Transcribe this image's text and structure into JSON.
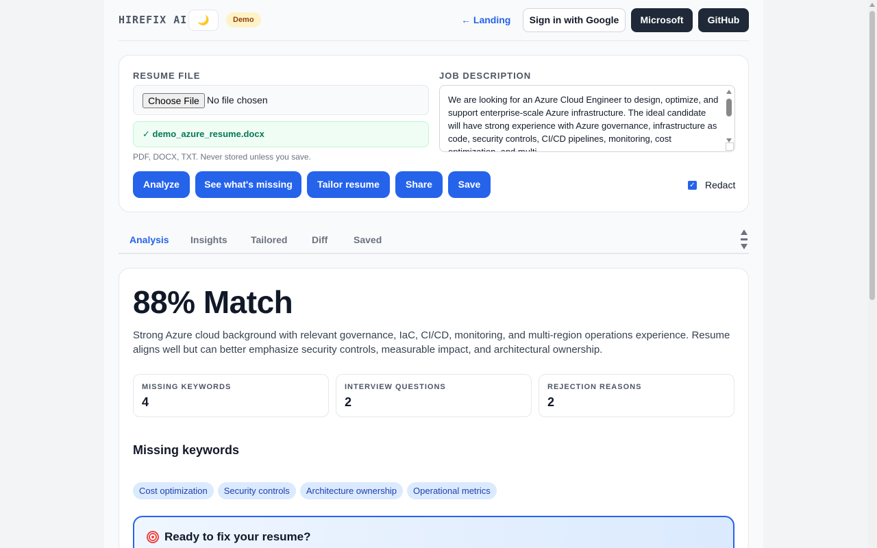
{
  "header": {
    "brand": "HIREFIX AI",
    "theme_icon": "moon-icon",
    "demo_badge": "Demo",
    "landing_link": "← Landing",
    "sign_in_google": "Sign in with Google",
    "microsoft": "Microsoft",
    "github": "GitHub"
  },
  "upload": {
    "resume_label": "RESUME FILE",
    "choose_file": "Choose File",
    "no_file": "No file chosen",
    "uploaded_file": "✓ demo_azure_resume.docx",
    "file_hint": "PDF, DOCX, TXT. Never stored unless you save.",
    "jd_label": "JOB DESCRIPTION",
    "jd_text": "We are looking for an Azure Cloud Engineer to design, optimize, and support enterprise-scale Azure infrastructure. The ideal candidate will have strong experience with Azure governance, infrastructure as code, security controls, CI/CD pipelines, monitoring, cost optimization, and multi-"
  },
  "actions": {
    "analyze": "Analyze",
    "see_missing": "See what's missing",
    "tailor": "Tailor resume",
    "share": "Share",
    "save": "Save",
    "redact_label": "Redact",
    "redact_checked": true
  },
  "tabs": [
    {
      "label": "Analysis",
      "active": true
    },
    {
      "label": "Insights",
      "active": false
    },
    {
      "label": "Tailored",
      "active": false
    },
    {
      "label": "Diff",
      "active": false
    },
    {
      "label": "Saved",
      "active": false
    }
  ],
  "analysis": {
    "match": "88% Match",
    "summary": "Strong Azure cloud background with relevant governance, IaC, CI/CD, monitoring, and multi-region operations experience. Resume aligns well but can better emphasize security controls, measurable impact, and architectural ownership.",
    "stats": [
      {
        "label": "MISSING KEYWORDS",
        "value": "4"
      },
      {
        "label": "INTERVIEW QUESTIONS",
        "value": "2"
      },
      {
        "label": "REJECTION REASONS",
        "value": "2"
      }
    ],
    "missing_title": "Missing keywords",
    "keywords": [
      "Cost optimization",
      "Security controls",
      "Architecture ownership",
      "Operational metrics"
    ],
    "cta": "Ready to fix your resume?"
  },
  "colors": {
    "primary": "#2563eb",
    "dark_button": "#1f2937",
    "success_bg": "#f0fdf4",
    "success_text": "#047857",
    "demo_bg": "#fef3c7"
  }
}
